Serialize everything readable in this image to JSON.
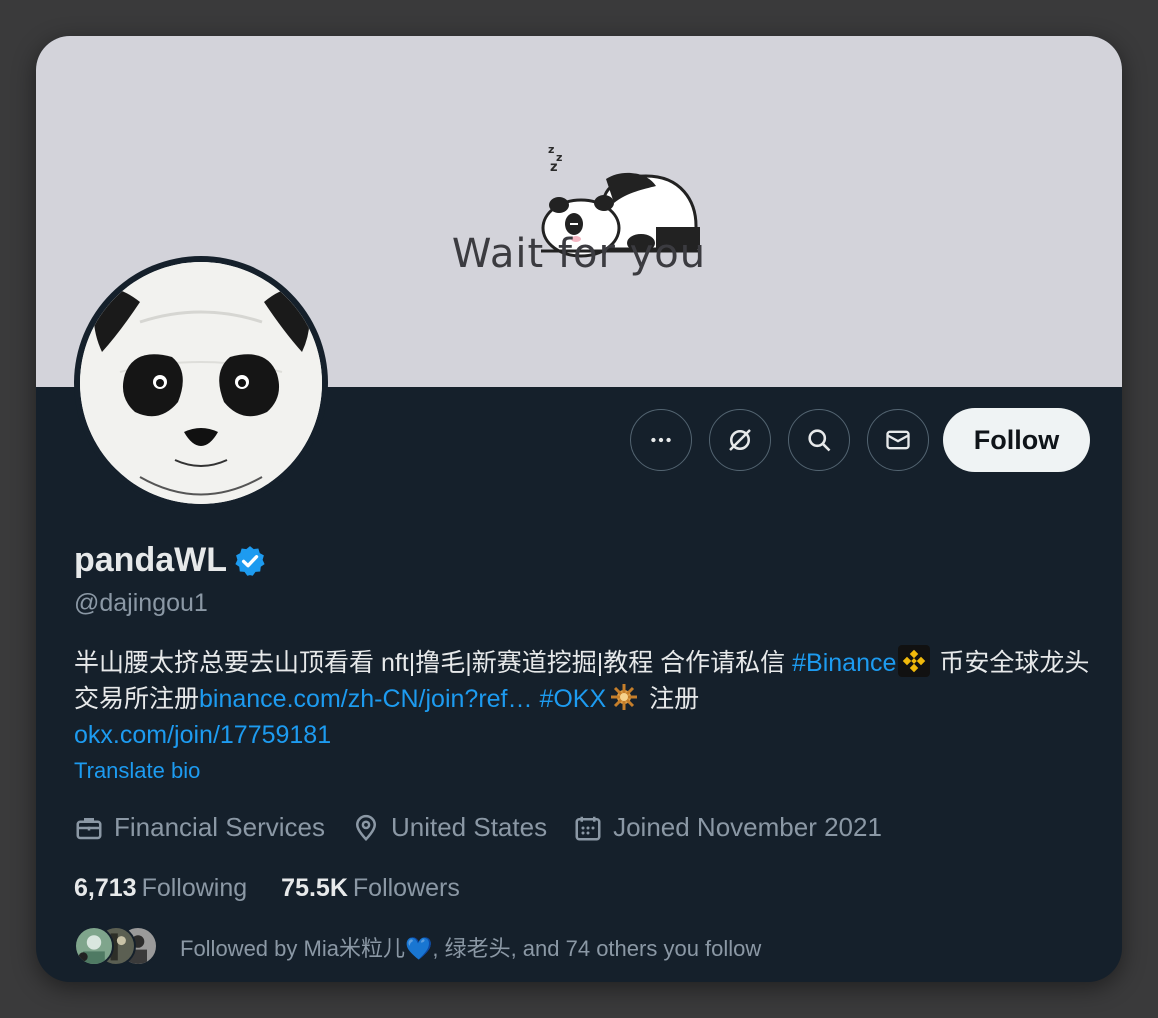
{
  "banner": {
    "text": "Wait for you"
  },
  "profile": {
    "display_name": "pandaWL",
    "handle": "@dajingou1",
    "verified_icon": "verified-badge-icon"
  },
  "actions": {
    "more_icon": "more-icon",
    "grok_icon": "grok-icon",
    "search_icon": "search-icon",
    "message_icon": "envelope-icon",
    "follow_label": "Follow"
  },
  "bio": {
    "text1": "半山腰太挤总要去山顶看看 nft|撸毛|新赛道挖掘|教程 合作请私信 ",
    "tag_binance": "#Binance",
    "text2": " 币安全球龙头交易所注册",
    "link_binance": "binance.com/zh-CN/join?ref…",
    "text3": " ",
    "tag_okx": "#OKX",
    "text4": " 注册",
    "link_okx": "okx.com/join/17759181"
  },
  "translate_label": "Translate bio",
  "meta": {
    "category": "Financial Services",
    "location": "United States",
    "joined": "Joined November 2021"
  },
  "stats": {
    "following_count": "6,713",
    "following_label": "Following",
    "followers_count": "75.5K",
    "followers_label": "Followers"
  },
  "followed_by": {
    "text": "Followed by Mia米粒儿💙, 绿老头, and 74 others you follow"
  },
  "colors": {
    "background": "#15202b",
    "banner": "#d3d3da",
    "accent": "#1d9bf0",
    "text_primary": "#e7e9ea",
    "text_secondary": "#8b98a5"
  }
}
